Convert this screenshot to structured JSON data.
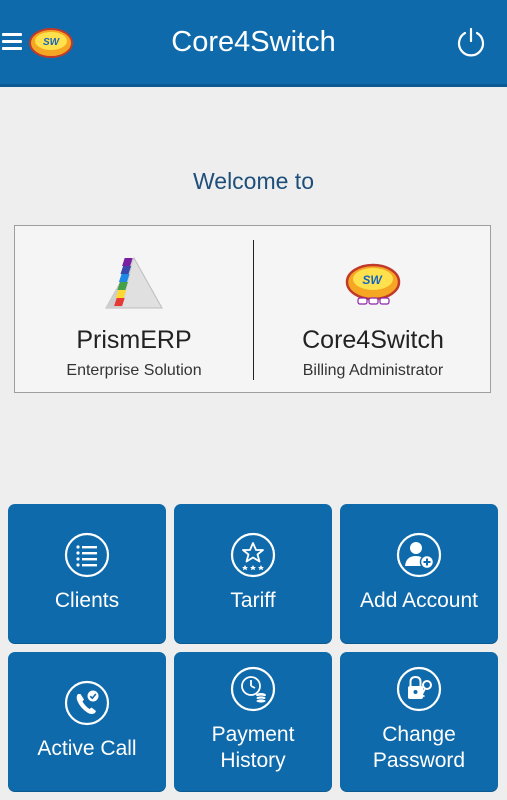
{
  "header": {
    "title": "Core4Switch",
    "logo_text": "SW"
  },
  "welcome_text": "Welcome to",
  "brands": {
    "left": {
      "name": "PrismERP",
      "subtitle": "Enterprise Solution"
    },
    "right": {
      "name": "Core4Switch",
      "subtitle": "Billing Administrator",
      "logo_text": "SW"
    }
  },
  "tiles": [
    {
      "label": "Clients",
      "icon": "list-icon"
    },
    {
      "label": "Tariff",
      "icon": "star-badge-icon"
    },
    {
      "label": "Add Account",
      "icon": "add-user-icon"
    },
    {
      "label": "Active Call",
      "icon": "phone-check-icon"
    },
    {
      "label_line1": "Payment",
      "label_line2": "History",
      "icon": "clock-coins-icon"
    },
    {
      "label_line1": "Change",
      "label_line2": "Password",
      "icon": "lock-key-icon"
    }
  ],
  "colors": {
    "primary": "#0e6aaa",
    "background": "#eeeeee",
    "welcome_text": "#1e4e7a"
  }
}
